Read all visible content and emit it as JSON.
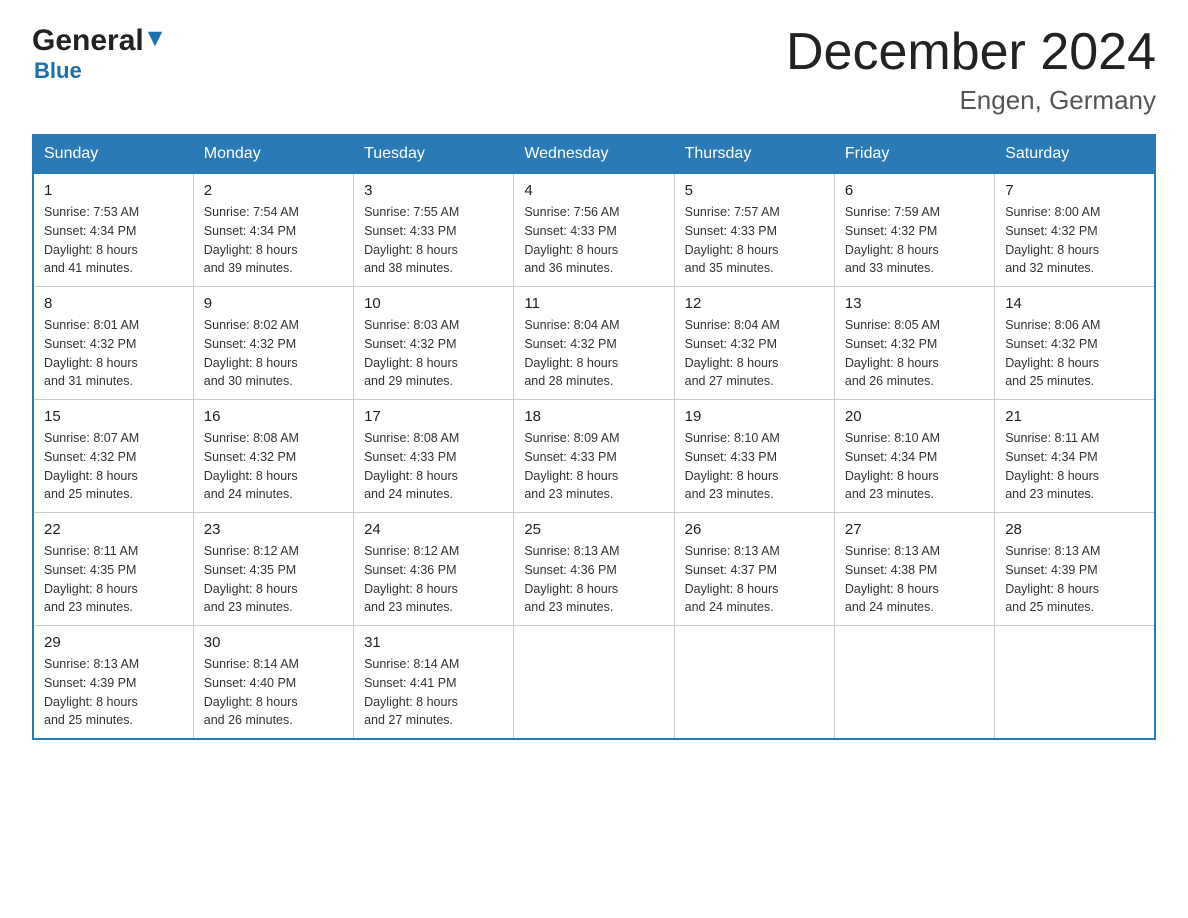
{
  "header": {
    "title": "December 2024",
    "subtitle": "Engen, Germany",
    "logo_general": "General",
    "logo_blue": "Blue"
  },
  "days_of_week": [
    "Sunday",
    "Monday",
    "Tuesday",
    "Wednesday",
    "Thursday",
    "Friday",
    "Saturday"
  ],
  "weeks": [
    [
      {
        "num": "1",
        "sunrise": "7:53 AM",
        "sunset": "4:34 PM",
        "daylight": "8 hours and 41 minutes."
      },
      {
        "num": "2",
        "sunrise": "7:54 AM",
        "sunset": "4:34 PM",
        "daylight": "8 hours and 39 minutes."
      },
      {
        "num": "3",
        "sunrise": "7:55 AM",
        "sunset": "4:33 PM",
        "daylight": "8 hours and 38 minutes."
      },
      {
        "num": "4",
        "sunrise": "7:56 AM",
        "sunset": "4:33 PM",
        "daylight": "8 hours and 36 minutes."
      },
      {
        "num": "5",
        "sunrise": "7:57 AM",
        "sunset": "4:33 PM",
        "daylight": "8 hours and 35 minutes."
      },
      {
        "num": "6",
        "sunrise": "7:59 AM",
        "sunset": "4:32 PM",
        "daylight": "8 hours and 33 minutes."
      },
      {
        "num": "7",
        "sunrise": "8:00 AM",
        "sunset": "4:32 PM",
        "daylight": "8 hours and 32 minutes."
      }
    ],
    [
      {
        "num": "8",
        "sunrise": "8:01 AM",
        "sunset": "4:32 PM",
        "daylight": "8 hours and 31 minutes."
      },
      {
        "num": "9",
        "sunrise": "8:02 AM",
        "sunset": "4:32 PM",
        "daylight": "8 hours and 30 minutes."
      },
      {
        "num": "10",
        "sunrise": "8:03 AM",
        "sunset": "4:32 PM",
        "daylight": "8 hours and 29 minutes."
      },
      {
        "num": "11",
        "sunrise": "8:04 AM",
        "sunset": "4:32 PM",
        "daylight": "8 hours and 28 minutes."
      },
      {
        "num": "12",
        "sunrise": "8:04 AM",
        "sunset": "4:32 PM",
        "daylight": "8 hours and 27 minutes."
      },
      {
        "num": "13",
        "sunrise": "8:05 AM",
        "sunset": "4:32 PM",
        "daylight": "8 hours and 26 minutes."
      },
      {
        "num": "14",
        "sunrise": "8:06 AM",
        "sunset": "4:32 PM",
        "daylight": "8 hours and 25 minutes."
      }
    ],
    [
      {
        "num": "15",
        "sunrise": "8:07 AM",
        "sunset": "4:32 PM",
        "daylight": "8 hours and 25 minutes."
      },
      {
        "num": "16",
        "sunrise": "8:08 AM",
        "sunset": "4:32 PM",
        "daylight": "8 hours and 24 minutes."
      },
      {
        "num": "17",
        "sunrise": "8:08 AM",
        "sunset": "4:33 PM",
        "daylight": "8 hours and 24 minutes."
      },
      {
        "num": "18",
        "sunrise": "8:09 AM",
        "sunset": "4:33 PM",
        "daylight": "8 hours and 23 minutes."
      },
      {
        "num": "19",
        "sunrise": "8:10 AM",
        "sunset": "4:33 PM",
        "daylight": "8 hours and 23 minutes."
      },
      {
        "num": "20",
        "sunrise": "8:10 AM",
        "sunset": "4:34 PM",
        "daylight": "8 hours and 23 minutes."
      },
      {
        "num": "21",
        "sunrise": "8:11 AM",
        "sunset": "4:34 PM",
        "daylight": "8 hours and 23 minutes."
      }
    ],
    [
      {
        "num": "22",
        "sunrise": "8:11 AM",
        "sunset": "4:35 PM",
        "daylight": "8 hours and 23 minutes."
      },
      {
        "num": "23",
        "sunrise": "8:12 AM",
        "sunset": "4:35 PM",
        "daylight": "8 hours and 23 minutes."
      },
      {
        "num": "24",
        "sunrise": "8:12 AM",
        "sunset": "4:36 PM",
        "daylight": "8 hours and 23 minutes."
      },
      {
        "num": "25",
        "sunrise": "8:13 AM",
        "sunset": "4:36 PM",
        "daylight": "8 hours and 23 minutes."
      },
      {
        "num": "26",
        "sunrise": "8:13 AM",
        "sunset": "4:37 PM",
        "daylight": "8 hours and 24 minutes."
      },
      {
        "num": "27",
        "sunrise": "8:13 AM",
        "sunset": "4:38 PM",
        "daylight": "8 hours and 24 minutes."
      },
      {
        "num": "28",
        "sunrise": "8:13 AM",
        "sunset": "4:39 PM",
        "daylight": "8 hours and 25 minutes."
      }
    ],
    [
      {
        "num": "29",
        "sunrise": "8:13 AM",
        "sunset": "4:39 PM",
        "daylight": "8 hours and 25 minutes."
      },
      {
        "num": "30",
        "sunrise": "8:14 AM",
        "sunset": "4:40 PM",
        "daylight": "8 hours and 26 minutes."
      },
      {
        "num": "31",
        "sunrise": "8:14 AM",
        "sunset": "4:41 PM",
        "daylight": "8 hours and 27 minutes."
      },
      null,
      null,
      null,
      null
    ]
  ],
  "labels": {
    "sunrise": "Sunrise:",
    "sunset": "Sunset:",
    "daylight": "Daylight:"
  }
}
